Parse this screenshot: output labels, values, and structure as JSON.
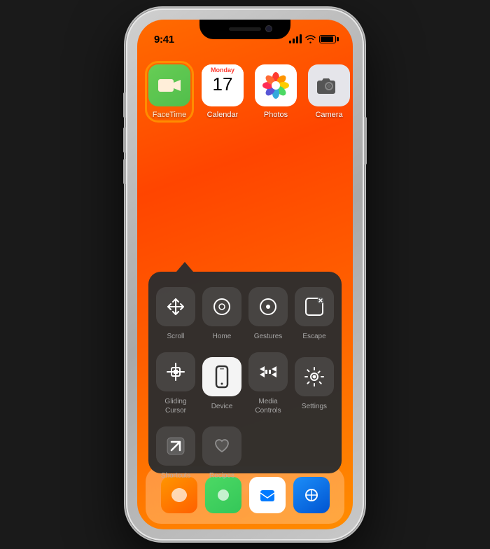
{
  "phone": {
    "status_bar": {
      "time": "9:41"
    }
  },
  "home_screen": {
    "apps": [
      {
        "id": "facetime",
        "label": "FaceTime",
        "highlighted": true
      },
      {
        "id": "calendar",
        "label": "Calendar",
        "day": "Monday",
        "date": "17"
      },
      {
        "id": "photos",
        "label": "Photos"
      },
      {
        "id": "camera",
        "label": "Camera"
      }
    ]
  },
  "assistive_menu": {
    "items": [
      {
        "id": "scroll",
        "label": "Scroll",
        "selected": false
      },
      {
        "id": "home",
        "label": "Home",
        "selected": false
      },
      {
        "id": "gestures",
        "label": "Gestures",
        "selected": false
      },
      {
        "id": "escape",
        "label": "Escape",
        "selected": false
      },
      {
        "id": "gliding-cursor",
        "label": "Gliding\nCursor",
        "selected": false
      },
      {
        "id": "device",
        "label": "Device",
        "selected": true
      },
      {
        "id": "media-controls",
        "label": "Media\nControls",
        "selected": false
      },
      {
        "id": "settings",
        "label": "Settings",
        "selected": false
      },
      {
        "id": "shortcuts",
        "label": "Shortcuts",
        "selected": false
      },
      {
        "id": "recipes",
        "label": "Recipes",
        "selected": false
      }
    ]
  },
  "page_dots": [
    {
      "active": false
    },
    {
      "active": true
    }
  ]
}
